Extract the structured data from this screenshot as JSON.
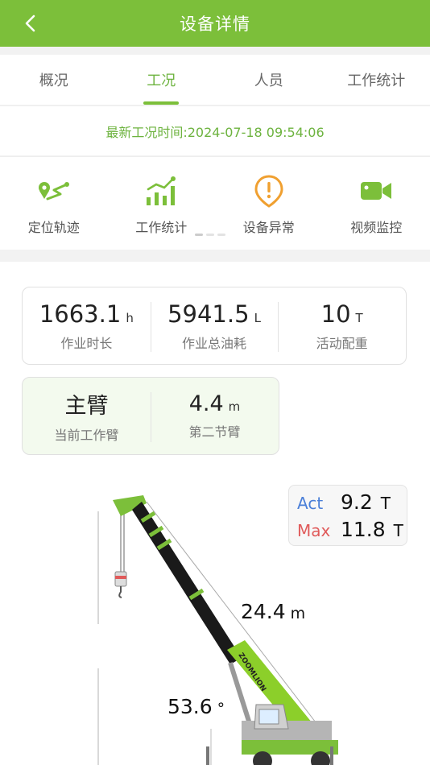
{
  "header": {
    "title": "设备详情"
  },
  "tabs": [
    {
      "label": "概况",
      "active": false
    },
    {
      "label": "工况",
      "active": true
    },
    {
      "label": "人员",
      "active": false
    },
    {
      "label": "工作统计",
      "active": false
    }
  ],
  "update": {
    "text": "最新工况时间:2024-07-18 09:54:06"
  },
  "quick_actions": [
    {
      "label": "定位轨迹",
      "icon": "location-track-icon"
    },
    {
      "label": "工作统计",
      "icon": "bar-chart-icon"
    },
    {
      "label": "设备异常",
      "icon": "warning-icon"
    },
    {
      "label": "视频监控",
      "icon": "video-camera-icon"
    }
  ],
  "stats": [
    {
      "value": "1663.1",
      "unit": "h",
      "caption": "作业时长"
    },
    {
      "value": "5941.5",
      "unit": "L",
      "caption": "作业总油耗"
    },
    {
      "value": "10",
      "unit": "T",
      "caption": "活动配重"
    }
  ],
  "boom": [
    {
      "value": "主臂",
      "unit": "",
      "caption": "当前工作臂"
    },
    {
      "value": "4.4",
      "unit": "m",
      "caption": "第二节臂"
    }
  ],
  "load": {
    "act_label": "Act",
    "act_value": "9.2",
    "act_unit": "T",
    "max_label": "Max",
    "max_value": "11.8",
    "max_unit": "T"
  },
  "crane": {
    "length_value": "24.4",
    "length_unit": "m",
    "angle_value": "53.6",
    "angle_unit": "°",
    "brand": "ZOOMLION"
  },
  "colors": {
    "brand_green": "#7cbf3a",
    "accent_orange": "#f0a030",
    "act_blue": "#4a7fd8",
    "max_red": "#e05b5b"
  }
}
